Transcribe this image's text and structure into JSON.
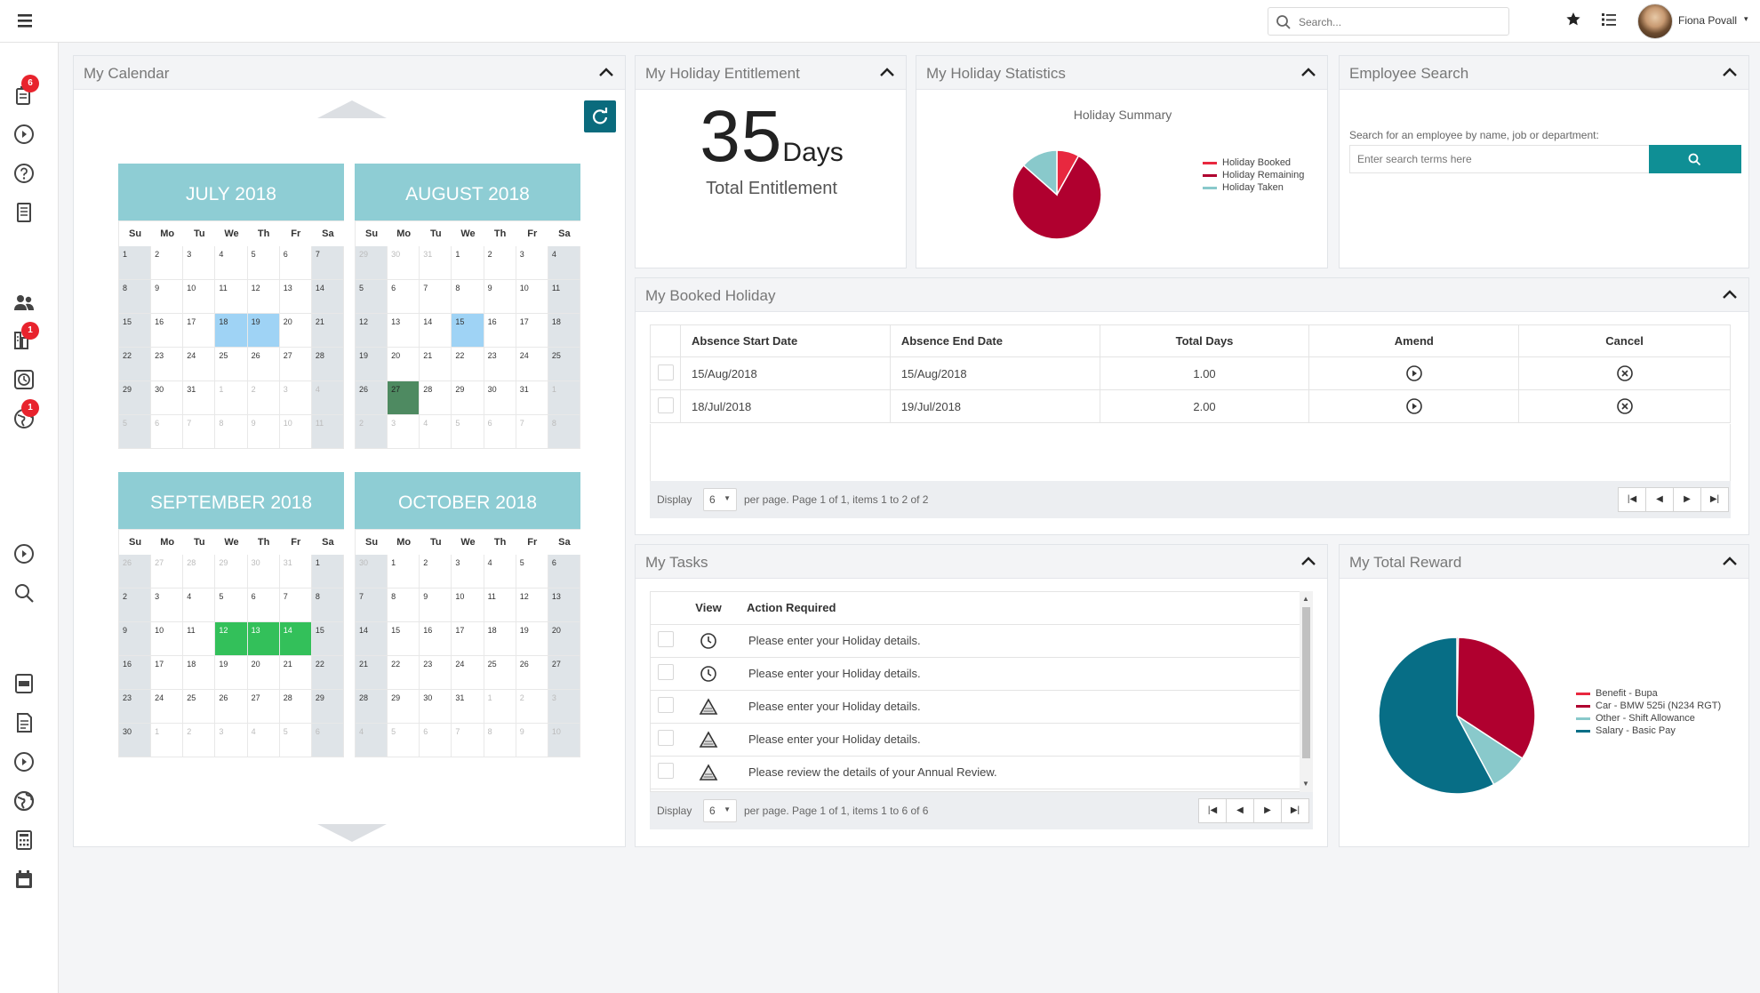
{
  "header": {
    "search_placeholder": "Search...",
    "user_name": "Fiona Povall",
    "user_caret": "▾"
  },
  "sidebar": {
    "badges": [
      "6",
      "1",
      "1"
    ]
  },
  "calendar": {
    "title": "My Calendar",
    "day_headers": [
      "Su",
      "Mo",
      "Tu",
      "We",
      "Th",
      "Fr",
      "Sa"
    ],
    "months": [
      {
        "name": "JULY 2018",
        "lead": [],
        "days": 31,
        "trail": [
          1,
          2,
          3,
          4,
          5,
          6,
          7,
          8,
          9,
          10,
          11
        ],
        "blue": [
          18,
          19
        ],
        "green": [],
        "dark": []
      },
      {
        "name": "AUGUST 2018",
        "lead": [
          29,
          30,
          31
        ],
        "days": 31,
        "trail": [
          1,
          2,
          3,
          4,
          5,
          6,
          7,
          8
        ],
        "blue": [
          15
        ],
        "green": [],
        "dark": [
          27
        ]
      },
      {
        "name": "SEPTEMBER 2018",
        "lead": [
          26,
          27,
          28,
          29,
          30,
          31
        ],
        "days": 30,
        "trail": [
          1,
          2,
          3,
          4,
          5,
          6
        ],
        "blue": [],
        "green": [
          12,
          13,
          14
        ],
        "dark": []
      },
      {
        "name": "OCTOBER 2018",
        "lead": [
          30
        ],
        "days": 31,
        "trail": [
          1,
          2,
          3,
          4,
          5,
          6,
          7,
          8,
          9,
          10
        ],
        "blue": [],
        "green": [],
        "dark": []
      }
    ]
  },
  "entitlement": {
    "title": "My Holiday Entitlement",
    "number": "35",
    "unit": "Days",
    "label": "Total Entitlement"
  },
  "statistics": {
    "title": "My Holiday Statistics",
    "chart_data": {
      "type": "pie",
      "title": "Holiday Summary",
      "labels": [
        "Holiday Booked",
        "Holiday Remaining",
        "Holiday Taken"
      ],
      "values": [
        3,
        29,
        5
      ],
      "colors": [
        "#e8283f",
        "#b0002f",
        "#89c9cb"
      ]
    }
  },
  "employee_search": {
    "title": "Employee Search",
    "label": "Search for an employee by name, job or department:",
    "placeholder": "Enter search terms here"
  },
  "booked": {
    "title": "My Booked Holiday",
    "columns": [
      "Absence Start Date",
      "Absence End Date",
      "Total Days",
      "Amend",
      "Cancel"
    ],
    "rows": [
      {
        "start": "15/Aug/2018",
        "end": "15/Aug/2018",
        "days": "1.00"
      },
      {
        "start": "18/Jul/2018",
        "end": "19/Jul/2018",
        "days": "2.00"
      }
    ],
    "pager": {
      "display": "Display",
      "size": "6",
      "text": "per page. Page 1 of 1, items 1 to 2 of 2"
    }
  },
  "tasks": {
    "title": "My Tasks",
    "columns": [
      "View",
      "Action Required"
    ],
    "rows": [
      {
        "icon": "clock-icon",
        "text": "Please enter your Holiday details."
      },
      {
        "icon": "clock-icon",
        "text": "Please enter your Holiday details."
      },
      {
        "icon": "warning-icon",
        "text": "Please enter your Holiday details."
      },
      {
        "icon": "warning-icon",
        "text": "Please enter your Holiday details."
      },
      {
        "icon": "warning-icon",
        "text": "Please review the details of your Annual Review."
      }
    ],
    "pager": {
      "display": "Display",
      "size": "6",
      "text": "per page. Page 1 of 1, items 1 to 6 of 6"
    }
  },
  "reward": {
    "title": "My Total Reward",
    "chart_data": {
      "type": "pie",
      "labels": [
        "Benefit - Bupa",
        "Car - BMW 525i (N234 RGT)",
        "Other - Shift Allowance",
        "Salary - Basic Pay"
      ],
      "values": [
        0.3,
        34,
        8,
        58
      ],
      "colors": [
        "#e8283f",
        "#b0002f",
        "#89c9cb",
        "#076e86"
      ]
    }
  }
}
